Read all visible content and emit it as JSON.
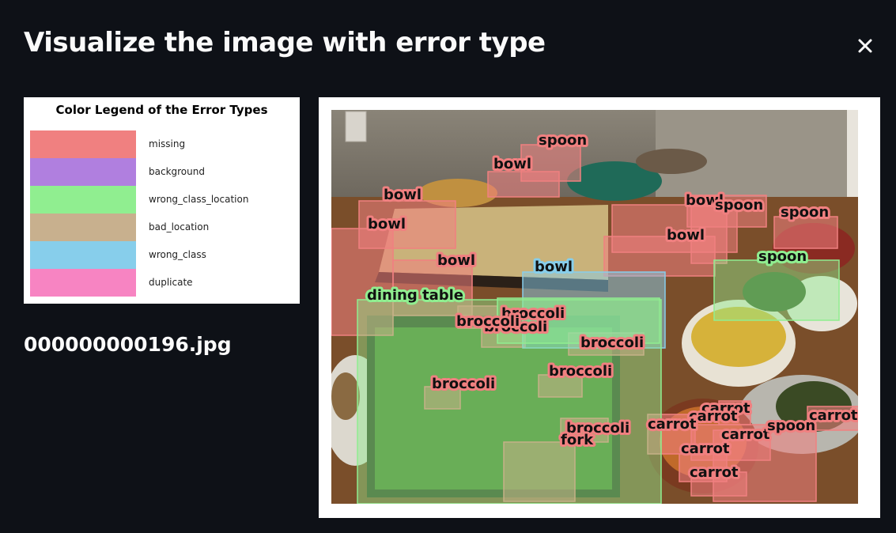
{
  "header": {
    "title": "Visualize the image with error type"
  },
  "legend": {
    "title": "Color Legend of the Error Types",
    "items": [
      {
        "label": "missing",
        "color": "#f08080"
      },
      {
        "label": "background",
        "color": "#b07fdf"
      },
      {
        "label": "wrong_class_location",
        "color": "#90ee90"
      },
      {
        "label": "bad_location",
        "color": "#c8b08e"
      },
      {
        "label": "wrong_class",
        "color": "#87ceeb"
      },
      {
        "label": "duplicate",
        "color": "#f784c2"
      }
    ]
  },
  "image": {
    "filename": "000000000196.jpg",
    "labels": {
      "spoon_top": "spoon",
      "bowl_top": "bowl",
      "bowl_left1": "bowl",
      "bowl_left2": "bowl",
      "bowl_mid": "bowl",
      "bowl_right": "bowl",
      "bowl_right_top": "bowl",
      "spoon_right1": "spoon",
      "spoon_right2": "spoon",
      "spoon_green": "spoon",
      "bowl_blue": "bowl",
      "dining_table": "dining table",
      "broccoli_1": "broccoli",
      "broccoli_2": "broccoli",
      "broccoli_3": "broccoli",
      "broccoli_4": "broccoli",
      "broccoli_5": "broccoli",
      "broccoli_6": "broccoli",
      "broccoli_7": "broccoli",
      "fork": "fork",
      "carrot_1": "carrot",
      "carrot_2": "carrot",
      "carrot_3": "carrot",
      "carrot_4": "carrot",
      "carrot_5": "carrot",
      "carrot_6": "carrot",
      "carrot_7": "carrot",
      "spoon_bottom": "spoon"
    }
  },
  "icons": {
    "close": "close-icon"
  }
}
